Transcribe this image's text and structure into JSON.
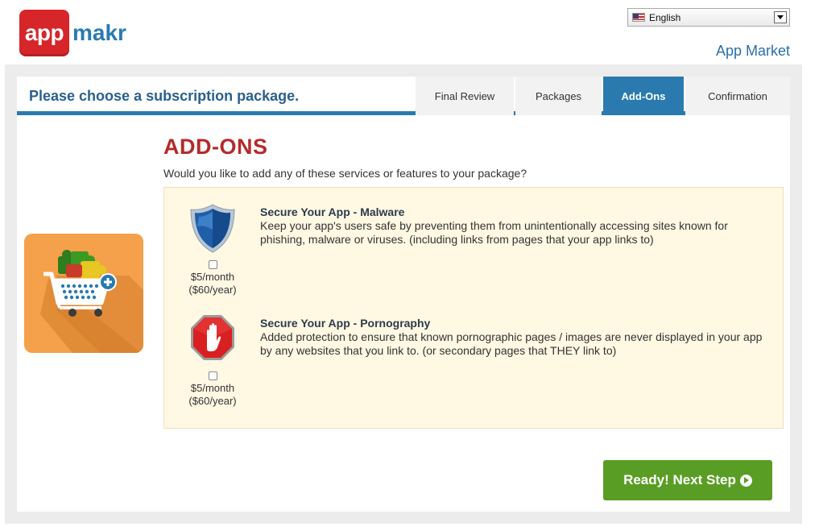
{
  "header": {
    "logo_app": "app",
    "logo_makr": "makr",
    "language": {
      "selected": "English"
    },
    "app_market_link": "App Market"
  },
  "topbar": {
    "title": "Please choose a subscription package.",
    "tabs": [
      {
        "label": "Final Review",
        "active": false
      },
      {
        "label": "Packages",
        "active": false
      },
      {
        "label": "Add-Ons",
        "active": true
      },
      {
        "label": "Confirmation",
        "active": false
      }
    ]
  },
  "main": {
    "heading": "ADD-ONS",
    "question": "Would you like to add any of these services or features to your package?",
    "addons": [
      {
        "icon": "shield-icon",
        "title": "Secure Your App - Malware",
        "description": "Keep your app's users safe by preventing them from unintentionally accessing sites known for phishing, malware or viruses. (including links from pages that your app links to)",
        "price_month": "$5/month",
        "price_year": "($60/year)",
        "checked": false
      },
      {
        "icon": "stop-hand-icon",
        "title": "Secure Your App - Pornography",
        "description": "Added protection to ensure that known pornographic pages / images are never displayed in your app by any websites that you link to. (or secondary pages that THEY link to)",
        "price_month": "$5/month",
        "price_year": "($60/year)",
        "checked": false
      }
    ],
    "next_button": "Ready! Next Step"
  },
  "colors": {
    "accent_blue": "#2a7ab0",
    "heading_red": "#b52a2a",
    "button_green": "#5a9d25",
    "addon_bg": "#fff8e3",
    "cart_bg": "#f5a04a"
  }
}
